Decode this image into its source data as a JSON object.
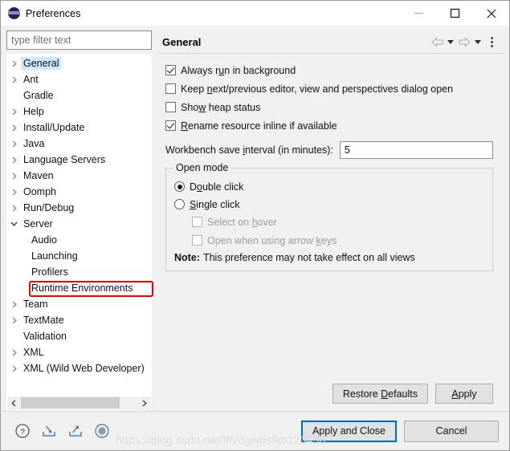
{
  "window": {
    "title": "Preferences",
    "logo_icon": "eclipse-logo",
    "controls": {
      "minimize": "minimize-icon",
      "maximize": "maximize-icon",
      "close": "close-icon"
    }
  },
  "filter": {
    "placeholder": "type filter text",
    "value": ""
  },
  "tree": {
    "items": [
      {
        "label": "General",
        "arrow": "collapsed",
        "depth": 0,
        "selected": true
      },
      {
        "label": "Ant",
        "arrow": "collapsed",
        "depth": 0,
        "selected": false
      },
      {
        "label": "Gradle",
        "arrow": "none",
        "depth": 0,
        "selected": false
      },
      {
        "label": "Help",
        "arrow": "collapsed",
        "depth": 0,
        "selected": false
      },
      {
        "label": "Install/Update",
        "arrow": "collapsed",
        "depth": 0,
        "selected": false
      },
      {
        "label": "Java",
        "arrow": "collapsed",
        "depth": 0,
        "selected": false
      },
      {
        "label": "Language Servers",
        "arrow": "collapsed",
        "depth": 0,
        "selected": false
      },
      {
        "label": "Maven",
        "arrow": "collapsed",
        "depth": 0,
        "selected": false
      },
      {
        "label": "Oomph",
        "arrow": "collapsed",
        "depth": 0,
        "selected": false
      },
      {
        "label": "Run/Debug",
        "arrow": "collapsed",
        "depth": 0,
        "selected": false
      },
      {
        "label": "Server",
        "arrow": "expanded",
        "depth": 0,
        "selected": false
      },
      {
        "label": "Audio",
        "arrow": "none",
        "depth": 1,
        "selected": false
      },
      {
        "label": "Launching",
        "arrow": "none",
        "depth": 1,
        "selected": false
      },
      {
        "label": "Profilers",
        "arrow": "none",
        "depth": 1,
        "selected": false
      },
      {
        "label": "Runtime Environments",
        "arrow": "none",
        "depth": 1,
        "selected": false,
        "annotated": true
      },
      {
        "label": "Team",
        "arrow": "collapsed",
        "depth": 0,
        "selected": false
      },
      {
        "label": "TextMate",
        "arrow": "collapsed",
        "depth": 0,
        "selected": false
      },
      {
        "label": "Validation",
        "arrow": "none",
        "depth": 0,
        "selected": false
      },
      {
        "label": "XML",
        "arrow": "collapsed",
        "depth": 0,
        "selected": false
      },
      {
        "label": "XML (Wild Web Developer)",
        "arrow": "collapsed",
        "depth": 0,
        "selected": false
      }
    ],
    "hscroll": {
      "left_icon": "chevron-left-icon",
      "right_icon": "chevron-right-icon"
    }
  },
  "annotation": {
    "color": "#f10000",
    "target": "Runtime Environments"
  },
  "page": {
    "title": "General",
    "toolbar": {
      "back_icon": "back-arrow-icon",
      "back_menu_icon": "chevron-down-icon",
      "forward_icon": "forward-arrow-icon",
      "forward_menu_icon": "chevron-down-icon",
      "menu_icon": "vertical-dots-icon"
    },
    "checkboxes": [
      {
        "label_pre": "Always r",
        "label_mnemonic": "u",
        "label_post": "n in background",
        "checked": true,
        "enabled": true
      },
      {
        "label_pre": "Keep ",
        "label_mnemonic": "n",
        "label_post": "ext/previous editor, view and perspectives dialog open",
        "checked": false,
        "enabled": true
      },
      {
        "label_pre": "Sho",
        "label_mnemonic": "w",
        "label_post": " heap status",
        "checked": false,
        "enabled": true
      },
      {
        "label_pre": "",
        "label_mnemonic": "R",
        "label_post": "ename resource inline if available",
        "checked": true,
        "enabled": true
      }
    ],
    "interval": {
      "label_pre": "Workbench save ",
      "label_mnemonic": "i",
      "label_post": "nterval (in minutes):",
      "value": "5"
    },
    "open_mode": {
      "legend": "Open mode",
      "radios": [
        {
          "label_pre": "D",
          "label_mnemonic": "o",
          "label_post": "uble click",
          "selected": true
        },
        {
          "label_pre": "",
          "label_mnemonic": "S",
          "label_post": "ingle click",
          "selected": false
        }
      ],
      "sub_checkboxes": [
        {
          "label_pre": "Select on ",
          "label_mnemonic": "h",
          "label_post": "over",
          "checked": false,
          "enabled": false
        },
        {
          "label_pre": "Open when using arrow ",
          "label_mnemonic": "k",
          "label_post": "eys",
          "checked": false,
          "enabled": false
        }
      ],
      "note_label": "Note:",
      "note_text": "This preference may not take effect on all views"
    },
    "buttons": {
      "restore_defaults_pre": "Restore ",
      "restore_defaults_mnemonic": "D",
      "restore_defaults_post": "efaults",
      "apply_pre": "",
      "apply_mnemonic": "A",
      "apply_post": "pply"
    }
  },
  "footer": {
    "icons": [
      {
        "name": "help-icon"
      },
      {
        "name": "import-icon"
      },
      {
        "name": "export-icon"
      },
      {
        "name": "record-icon"
      }
    ],
    "apply_and_close": "Apply and Close",
    "cancel": "Cancel"
  },
  "watermark": "https://blog.csdn.net/fffvdgjvbsfkb123456"
}
